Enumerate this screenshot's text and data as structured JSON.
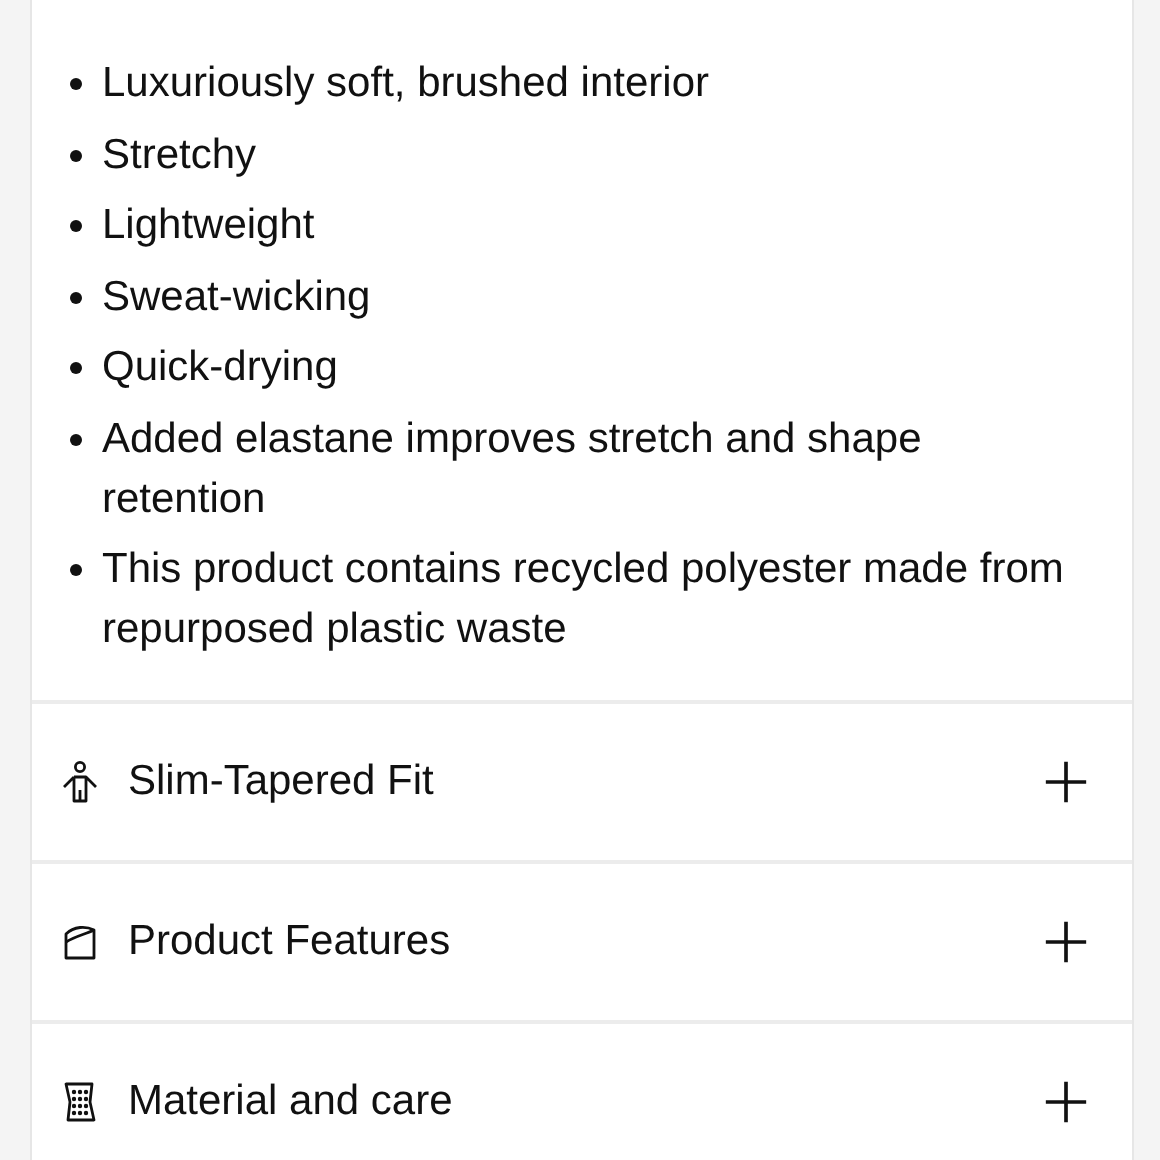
{
  "features": [
    {
      "text": "Luxuriously soft, brushed interior"
    },
    {
      "text": "Stretchy"
    },
    {
      "text": "Lightweight"
    },
    {
      "text": "Sweat-wicking"
    },
    {
      "text": "Quick-drying"
    },
    {
      "text": "Added elastane improves stretch and shape retention"
    },
    {
      "text": "This product contains recycled polyester made from repurposed plastic waste"
    }
  ],
  "sections": [
    {
      "kind": "fit",
      "label": "Slim-Tapered Fit",
      "expanded": false
    },
    {
      "kind": "features",
      "label": "Product Features",
      "expanded": false
    },
    {
      "kind": "material",
      "label": "Material and care",
      "expanded": false
    }
  ]
}
